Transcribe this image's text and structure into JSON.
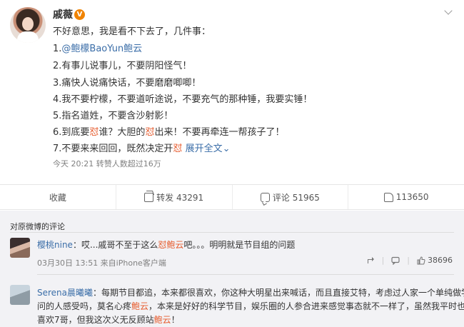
{
  "post": {
    "username": "戚薇",
    "verified_badge": "V",
    "lines": {
      "intro": "不好意思，我是看不下去了，几件事：",
      "l1_prefix": "1.",
      "l1_mention": "@鲍檬BaoYun鲍云",
      "l2": "2.有事儿说事儿，不要阴阳怪气！",
      "l3": "3.痛快人说痛快话，不要磨磨唧唧！",
      "l4": "4.我不要柠檬，不要道听途说，不要充气的那种锤，我要实锤！",
      "l5": "5.指名道姓，不要含沙射影！",
      "l6_a": "6.到底要",
      "l6_b": "怼",
      "l6_c": "谁？大胆的",
      "l6_d": "怼",
      "l6_e": "出来！不要再牵连一帮孩子了！",
      "l7_a": "7.不要来来回回，既然决定开",
      "l7_b": "怼",
      "l7_more": "展开全文",
      "l7_chevron": "⌄"
    },
    "meta": "今天 20:21 转赞人数超过16万"
  },
  "actions": {
    "favorite": "收藏",
    "repost": "转发 43291",
    "comment": "评论 51965",
    "like": "113650"
  },
  "comments": {
    "title": "对原微博的评论",
    "items": [
      {
        "name": "樱桃nine",
        "text_a": "：哎...戚哥不至于这么",
        "text_b": "怼鲍云",
        "text_c": "吧。。。明明就是节目组的问题",
        "meta": "03月30日 13:51 来自iPhone客户端",
        "like": "38696"
      },
      {
        "name": "Serena晨曦曦",
        "line1": "：每期节目都追，本来都很喜欢，你这种大明星出来喊话，而且直接艾特，考虑过人家一个单纯做学",
        "line2_a": "问的人感受吗，莫名心疼",
        "line2_b": "鲍云",
        "line2_c": "，本来是好好的科学节目，娱乐圈的人参合进来感觉事态就不一样了，虽然我平时也很",
        "line3_a": "喜欢7哥，但我这次义无反顾站",
        "line3_b": "鲍云",
        "line3_c": "！"
      }
    ]
  },
  "colors": {
    "accent": "#eb7350",
    "link": "#3b6ea8",
    "comments_bg": "#f2f2f5"
  }
}
